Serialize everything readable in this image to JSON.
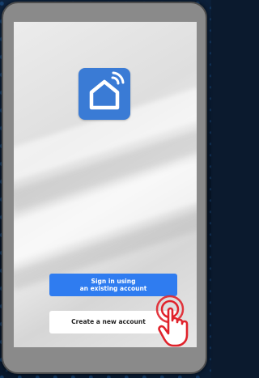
{
  "buttons": {
    "sign_in": {
      "line1": "Sign in using",
      "line2": "an existing account"
    },
    "create": {
      "label": "Create a new account"
    }
  },
  "icons": {
    "app_logo": "smart-home-icon",
    "pointer": "tap-hand-icon"
  },
  "colors": {
    "primary_button": "#2f7cf0",
    "app_icon_bg": "#3a7bd5",
    "tap_highlight": "#e0222b"
  }
}
